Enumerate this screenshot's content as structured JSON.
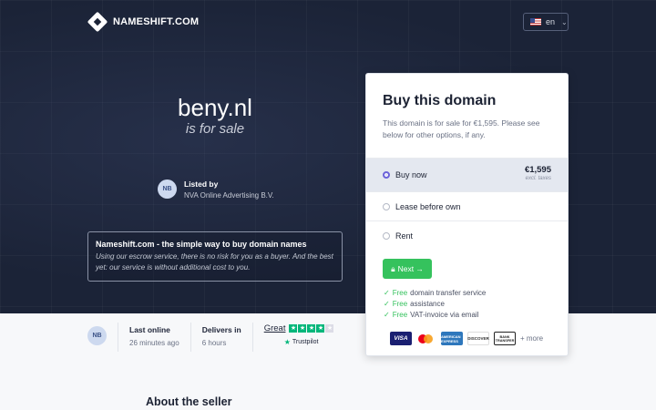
{
  "header": {
    "logo_text": "NAMESHIFT.COM",
    "language": "en"
  },
  "hero": {
    "domain": "beny.nl",
    "subtitle": "is for sale",
    "listed_by_label": "Listed by",
    "listed_by_name": "NVA Online Advertising B.V.",
    "seller_initials": "NB"
  },
  "info_box": {
    "title": "Nameshift.com - the simple way to buy domain names",
    "text": "Using our escrow service, there is no risk for you as a buyer. And the best yet: our service is without additional cost to you."
  },
  "stats": {
    "initials": "NB",
    "last_online_label": "Last online",
    "last_online_value": "26 minutes ago",
    "delivers_label": "Delivers in",
    "delivers_value": "6 hours",
    "trustpilot_rating": "Great",
    "trustpilot_stars": 4,
    "trustpilot_brand": "Trustpilot"
  },
  "card": {
    "title": "Buy this domain",
    "description": "This domain is for sale for €1,595. Please see below for other options, if any.",
    "options": [
      {
        "label": "Buy now",
        "price": "€1,595",
        "tax_note": "excl. taxes",
        "selected": true
      },
      {
        "label": "Lease before own",
        "selected": false
      },
      {
        "label": "Rent",
        "selected": false
      }
    ],
    "next_button": "Next →",
    "features": [
      {
        "free": "Free",
        "text": "domain transfer service"
      },
      {
        "free": "Free",
        "text": "assistance"
      },
      {
        "free": "Free",
        "text": "VAT-invoice via email"
      }
    ],
    "payment_methods": [
      "VISA",
      "mastercard-icon",
      "AMERICAN EXPRESS",
      "DISCOVER",
      "BANK TRANSFER"
    ],
    "more_label": "+ more"
  },
  "about_title": "About the seller",
  "colors": {
    "hero_bg": "#1b2337",
    "accent_green": "#35c25d",
    "radio_purple": "#6c63d9",
    "trustpilot_green": "#00b67a"
  }
}
